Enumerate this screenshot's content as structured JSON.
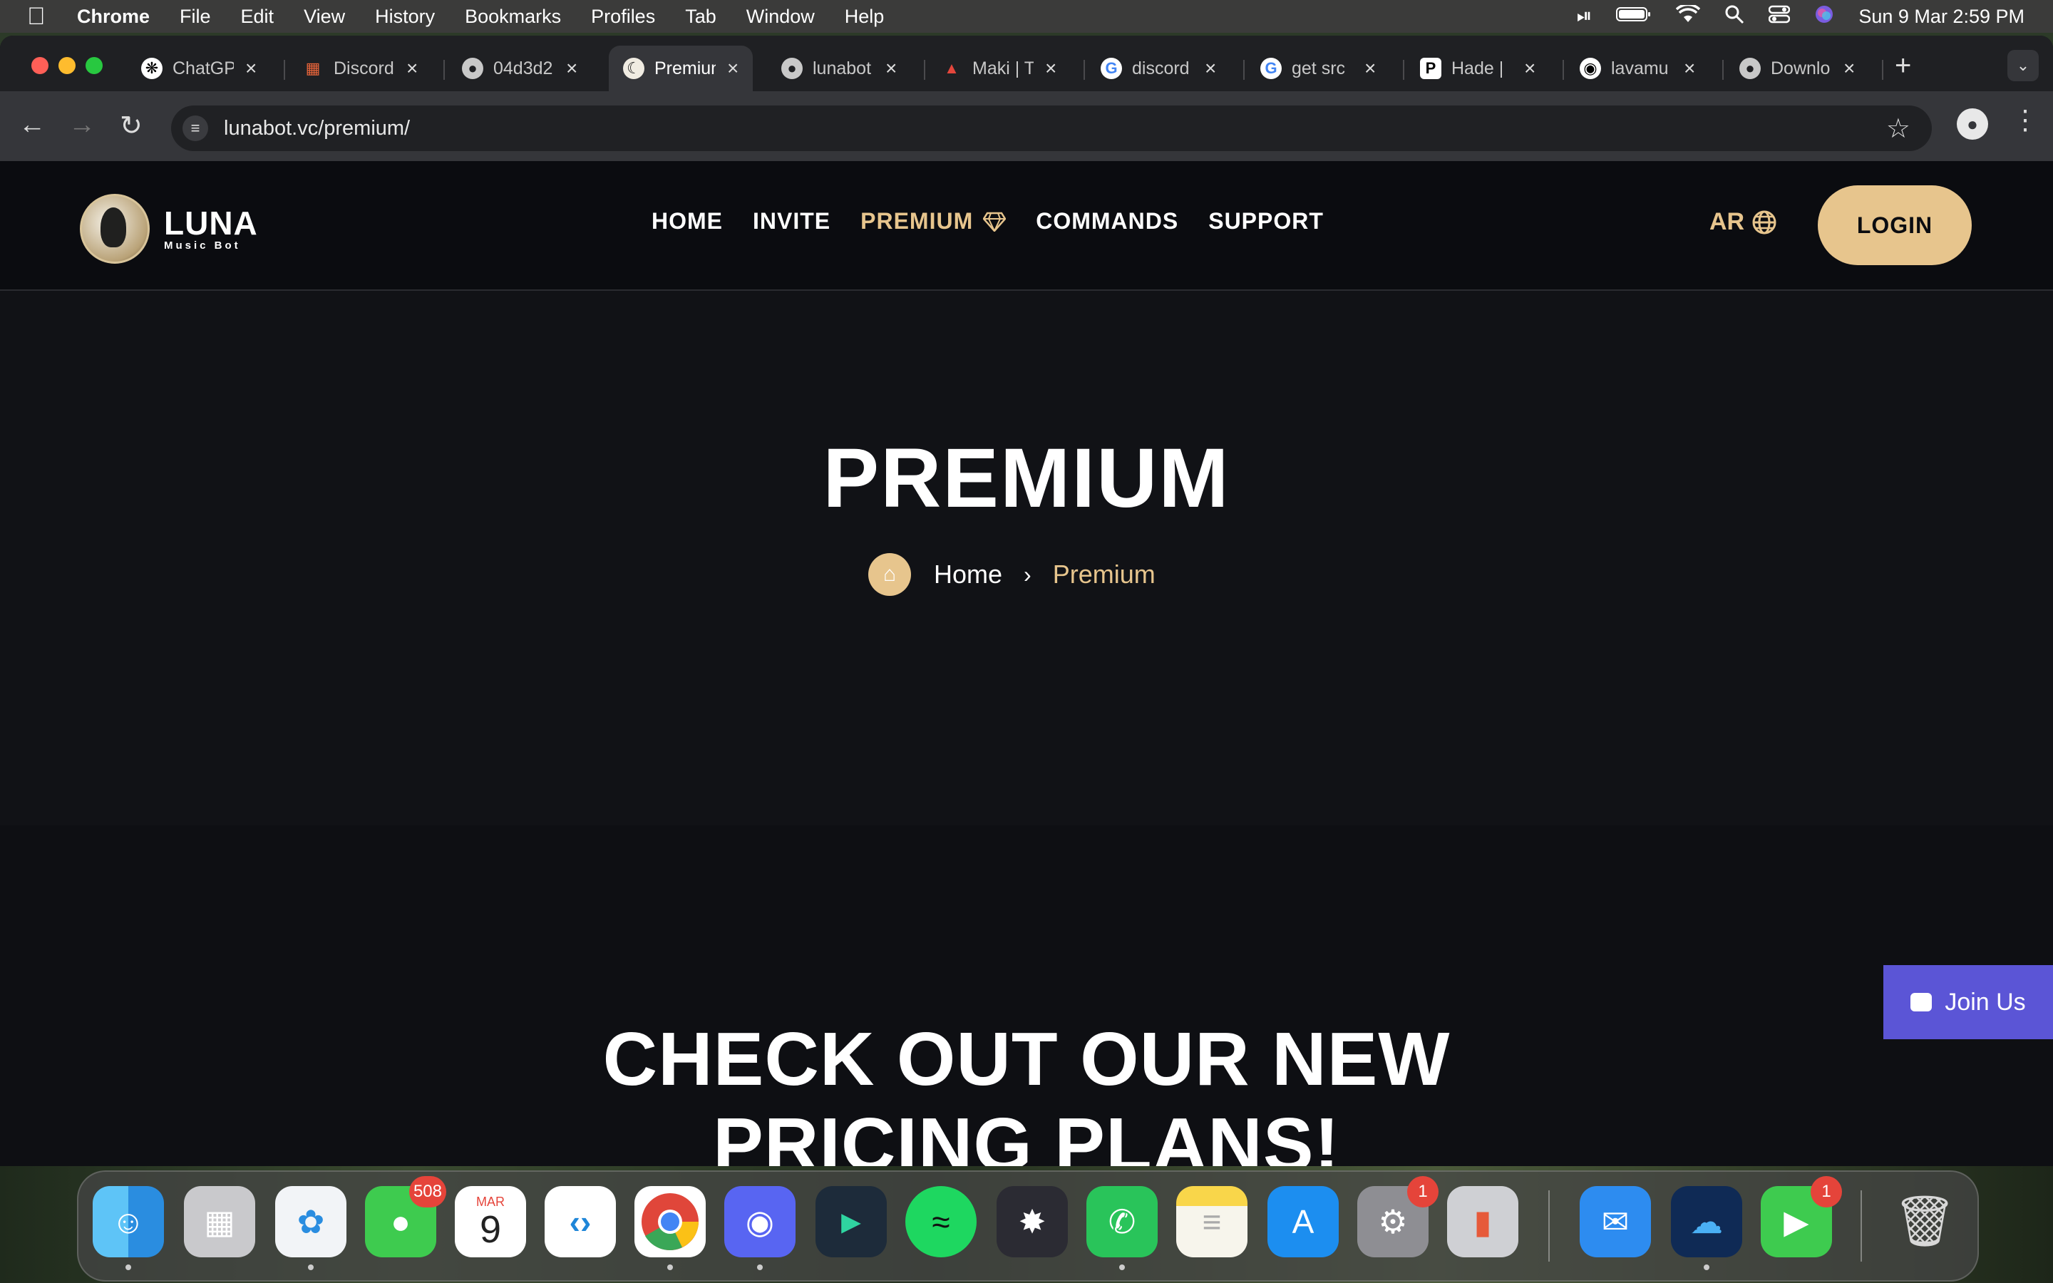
{
  "menubar": {
    "app_name": "Chrome",
    "menus": [
      "File",
      "Edit",
      "View",
      "History",
      "Bookmarks",
      "Profiles",
      "Tab",
      "Window",
      "Help"
    ],
    "clock": "Sun 9 Mar  2:59 PM"
  },
  "tabs": [
    {
      "title": "ChatGPT",
      "icon": "openai-icon"
    },
    {
      "title": "Discord",
      "icon": "discord-grid-icon"
    },
    {
      "title": "04d3d2",
      "icon": "globe-icon"
    },
    {
      "title": "Premium",
      "icon": "luna-icon",
      "active": true
    },
    {
      "title": "lunabot",
      "icon": "globe-icon"
    },
    {
      "title": "Maki | T",
      "icon": "maki-icon"
    },
    {
      "title": "discord",
      "icon": "google-icon"
    },
    {
      "title": "get src",
      "icon": "google-icon"
    },
    {
      "title": "Hade |",
      "icon": "hade-icon"
    },
    {
      "title": "lavamu",
      "icon": "github-icon"
    },
    {
      "title": "Downlo",
      "icon": "globe-icon"
    }
  ],
  "toolbar": {
    "url": "lunabot.vc/premium/"
  },
  "site": {
    "logo_name": "LUNA",
    "logo_tagline": "Music Bot",
    "nav": {
      "home": "HOME",
      "invite": "INVITE",
      "premium": "PREMIUM",
      "commands": "COMMANDS",
      "support": "SUPPORT"
    },
    "lang": "AR",
    "login": "LOGIN",
    "accent_color": "#e7c58d"
  },
  "hero": {
    "title": "PREMIUM",
    "breadcrumb_home": "Home",
    "breadcrumb_current": "Premium"
  },
  "pricing": {
    "title_line1": "CHECK OUT OUR NEW",
    "title_line2": "PRICING PLANS!"
  },
  "join_us": {
    "label": "Join Us",
    "color": "#5b55d6"
  },
  "dock": {
    "messages_badge": "508",
    "calendar_month": "MAR",
    "calendar_day": "9",
    "settings_badge": "1",
    "facetime_badge": "1"
  }
}
